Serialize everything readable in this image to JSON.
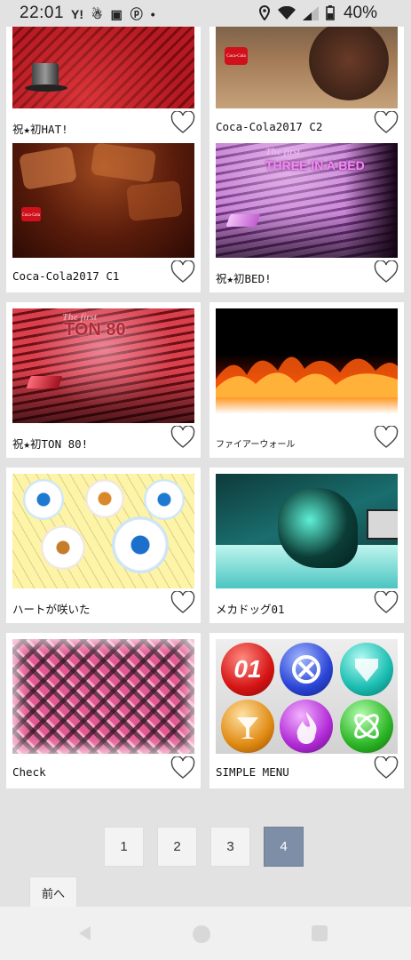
{
  "status": {
    "time": "22:01",
    "battery": "40%",
    "app_icons": [
      "Y!",
      "cat-icon",
      "app-icon",
      "pinterest-icon",
      "dot"
    ]
  },
  "items": [
    {
      "title": "祝★初HAT!"
    },
    {
      "title": "Coca-Cola2017 C2"
    },
    {
      "title": "Coca-Cola2017 C1"
    },
    {
      "title": "祝★初BED!"
    },
    {
      "title": "祝★初TON 80!"
    },
    {
      "title": "ファイアーウォール"
    },
    {
      "title": "ハートが咲いた"
    },
    {
      "title": "メカドッグ01"
    },
    {
      "title": "Check"
    },
    {
      "title": "SIMPLE MENU"
    }
  ],
  "thumb_text": {
    "bed_small": "The first",
    "bed_big": "THREE IN A BED",
    "ton_small": "The first",
    "ton_big": "TON 80",
    "menu_01": "01",
    "cola_logo": "Coca-Cola"
  },
  "pagination": {
    "pages": [
      "1",
      "2",
      "3",
      "4"
    ],
    "current": "4",
    "prev_label": "前へ"
  },
  "colors": {
    "background": "#e2e2e2",
    "active_page": "#7d8ea6"
  }
}
